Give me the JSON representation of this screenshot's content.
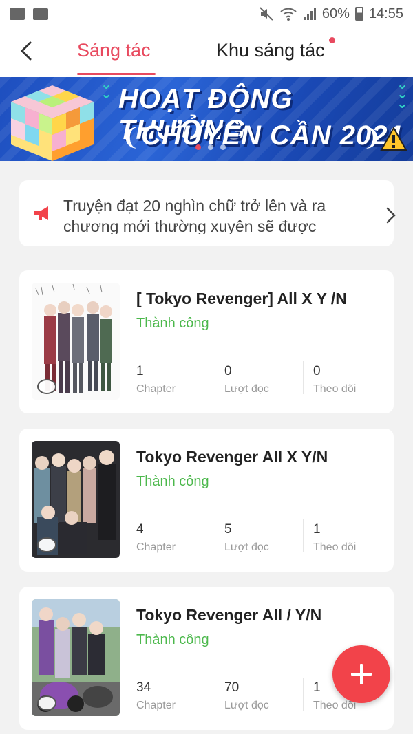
{
  "status_bar": {
    "battery": "60%",
    "time": "14:55"
  },
  "header": {
    "tabs": [
      {
        "label": "Sáng tác",
        "active": true
      },
      {
        "label": "Khu sáng tác",
        "active": false,
        "has_dot": true
      }
    ]
  },
  "banner": {
    "line1": "HOẠT ĐỘNG THƯỞNG",
    "line2": "CHUYÊN CẦN 2021"
  },
  "notice": {
    "text": "Truyện đạt 20 nghìn chữ trở lên và ra chương mới thường xuyên sẽ được"
  },
  "stories": [
    {
      "title": "[ Tokyo Revenger] All X Y /N",
      "status": "Thành công",
      "stats": [
        {
          "value": "1",
          "label": "Chapter"
        },
        {
          "value": "0",
          "label": "Lượt đọc"
        },
        {
          "value": "0",
          "label": "Theo dõi"
        }
      ]
    },
    {
      "title": "Tokyo Revenger All X Y/N",
      "status": "Thành công",
      "stats": [
        {
          "value": "4",
          "label": "Chapter"
        },
        {
          "value": "5",
          "label": "Lượt đọc"
        },
        {
          "value": "1",
          "label": "Theo dõi"
        }
      ]
    },
    {
      "title": "Tokyo Revenger All / Y/N",
      "status": "Thành công",
      "stats": [
        {
          "value": "34",
          "label": "Chapter"
        },
        {
          "value": "70",
          "label": "Lượt đọc"
        },
        {
          "value": "1",
          "label": "Theo dõi"
        }
      ]
    }
  ],
  "colors": {
    "accent": "#e84a5f",
    "success": "#4cb84c",
    "fab": "#f2434a"
  }
}
